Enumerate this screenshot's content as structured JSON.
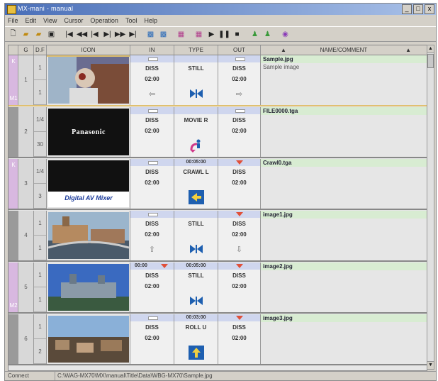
{
  "window": {
    "title": "MX-mani - manual",
    "buttons": [
      "_",
      "□",
      "x"
    ]
  },
  "menu": [
    "File",
    "Edit",
    "View",
    "Cursor",
    "Operation",
    "Tool",
    "Help"
  ],
  "columns": {
    "g": "G",
    "df": "D.F",
    "icon": "ICON",
    "in": "IN",
    "type": "TYPE",
    "out": "OUT",
    "name": "NAME/COMMENT"
  },
  "rows": [
    {
      "group": "1",
      "df": [
        "1",
        "1"
      ],
      "marks": [
        "K",
        "M1"
      ],
      "in": {
        "top": "",
        "line1": "DISS",
        "line2": "02:00",
        "arrow": "⇦"
      },
      "type": {
        "top": "",
        "line1": "STILL",
        "line2": "",
        "icon": "mix-icon"
      },
      "out": {
        "top": "",
        "line1": "DISS",
        "line2": "02:00",
        "arrow": "⇨"
      },
      "name": "Sample.jpg",
      "comment": "Sample image",
      "thumb": "photo-icon"
    },
    {
      "group": "2",
      "df": [
        "1/4",
        "30"
      ],
      "marks": [],
      "in": {
        "top": "",
        "line1": "DISS",
        "line2": "02:00",
        "arrow": ""
      },
      "type": {
        "top": "",
        "line1": "MOVIE R",
        "line2": "",
        "icon": "movie-icon"
      },
      "out": {
        "top": "",
        "line1": "DISS",
        "line2": "02:00",
        "arrow": ""
      },
      "name": "FILE0000.tga",
      "comment": "",
      "thumb": "panasonic-logo",
      "thumb_text": "Panasonic"
    },
    {
      "group": "3",
      "df": [
        "1/4",
        "3"
      ],
      "marks": [
        "K"
      ],
      "in": {
        "top": "",
        "line1": "DISS",
        "line2": "02:00",
        "arrow": ""
      },
      "type": {
        "top": "00:05:00",
        "line1": "CRAWL L",
        "line2": "",
        "icon": "left-arrow-icon"
      },
      "out": {
        "top": "",
        "line1": "DISS",
        "line2": "02:00",
        "arrow": ""
      },
      "name": "Crawl0.tga",
      "comment": "",
      "thumb": "mixer-logo",
      "thumb_text": "Digital AV Mixer"
    },
    {
      "group": "4",
      "df": [
        "1",
        "1"
      ],
      "marks": [],
      "in": {
        "top": "",
        "line1": "DISS",
        "line2": "02:00",
        "arrow": "⇧"
      },
      "type": {
        "top": "",
        "line1": "STILL",
        "line2": "",
        "icon": "mix-icon"
      },
      "out": {
        "top": "",
        "line1": "DISS",
        "line2": "02:00",
        "arrow": "⇩"
      },
      "name": "image1.jpg",
      "comment": "",
      "thumb": "city-photo"
    },
    {
      "group": "5",
      "df": [
        "1",
        "1"
      ],
      "marks": [
        "M2"
      ],
      "in": {
        "top": "00:00",
        "line1": "DISS",
        "line2": "02:00",
        "arrow": ""
      },
      "type": {
        "top": "00:05:00",
        "line1": "STILL",
        "line2": "",
        "icon": "mix-icon"
      },
      "out": {
        "top": "",
        "line1": "DISS",
        "line2": "02:00",
        "arrow": ""
      },
      "name": "image2.jpg",
      "comment": "",
      "thumb": "castle-photo"
    },
    {
      "group": "6",
      "df": [
        "1",
        "2"
      ],
      "marks": [],
      "in": {
        "top": "",
        "line1": "DISS",
        "line2": "02:00",
        "arrow": ""
      },
      "type": {
        "top": "00:03:00",
        "line1": "ROLL U",
        "line2": "",
        "icon": "up-arrow-icon"
      },
      "out": {
        "top": "",
        "line1": "DISS",
        "line2": "02:00",
        "arrow": ""
      },
      "name": "image3.jpg",
      "comment": "",
      "thumb": "town-photo"
    }
  ],
  "status": {
    "left": "Connect",
    "path": "C:\\WAG-MX70\\MX\\manual\\Title\\Data\\WBG-MX70\\Sample.jpg"
  },
  "colors": {
    "name_highlight": "#d8ecd2",
    "band": "#cfd6ee",
    "marker_red": "#e0503a",
    "type_icon_blue": "#1e5fb0"
  }
}
